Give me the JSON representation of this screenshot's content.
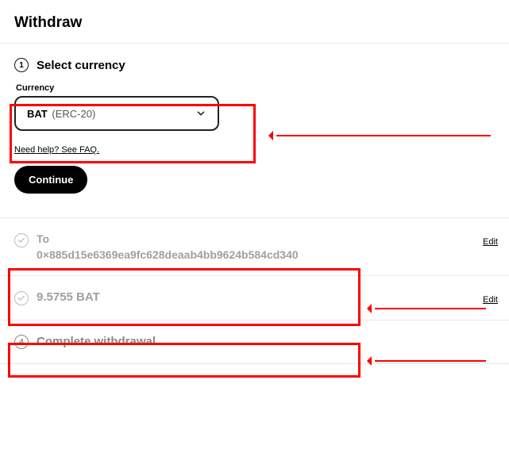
{
  "page": {
    "title": "Withdraw"
  },
  "step1": {
    "number": "1",
    "title": "Select currency",
    "currency_label": "Currency",
    "currency_symbol": "BAT",
    "currency_network": "(ERC-20)",
    "faq_text": "Need help? See FAQ.",
    "continue_label": "Continue"
  },
  "step2": {
    "label": "To",
    "address": "0×885d15e6369ea9fc628deaab4bb9624b584cd340",
    "edit_label": "Edit"
  },
  "step3": {
    "amount": "9.5755 BAT",
    "edit_label": "Edit"
  },
  "step4": {
    "number": "4",
    "title": "Complete withdrawal"
  }
}
